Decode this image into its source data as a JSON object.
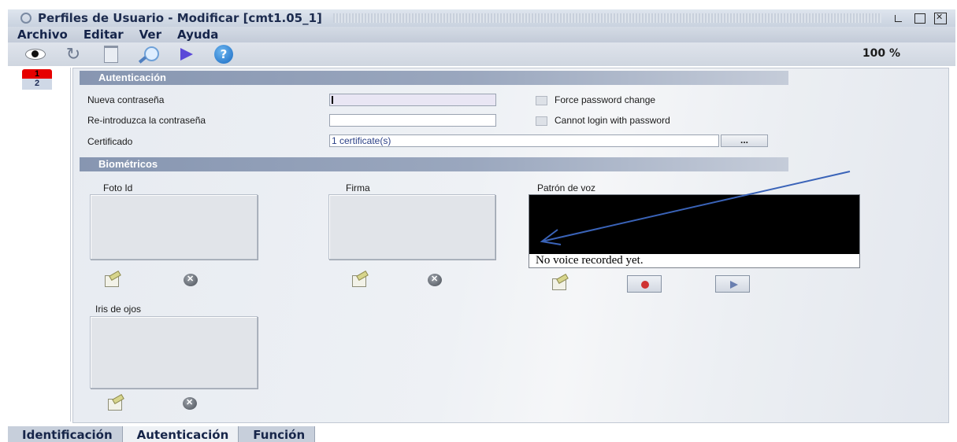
{
  "window": {
    "title": "Perfiles de Usuario - Modificar [cmt1.05_1]"
  },
  "menu": [
    "Archivo",
    "Editar",
    "Ver",
    "Ayuda"
  ],
  "toolbar": {
    "icons": [
      "view-icon",
      "refresh-icon",
      "delete-icon",
      "search-icon",
      "play-icon",
      "help-icon"
    ],
    "help_glyph": "?",
    "zoom": "100 %"
  },
  "side_tabs": [
    "1",
    "2"
  ],
  "authentication": {
    "header": "Autenticación",
    "new_password_label": "Nueva contraseña",
    "reenter_password_label": "Re-introduzca la contraseña",
    "certificate_label": "Certificado",
    "certificate_value": "1 certificate(s)",
    "certificate_button": "...",
    "force_change_label": "Force password change",
    "cannot_login_label": "Cannot login with password"
  },
  "biometrics": {
    "header": "Biométricos",
    "photo_label": "Foto Id",
    "signature_label": "Firma",
    "voice_label": "Patrón de voz",
    "voice_status": "No voice recorded yet.",
    "iris_label": "Iris de ojos"
  },
  "bottom_tabs": [
    "Identificación",
    "Autenticación",
    "Función"
  ],
  "colors": {
    "active_side_tab": "#e60000",
    "section_header": "#8796b1",
    "annotation_arrow": "#3a63b8"
  }
}
